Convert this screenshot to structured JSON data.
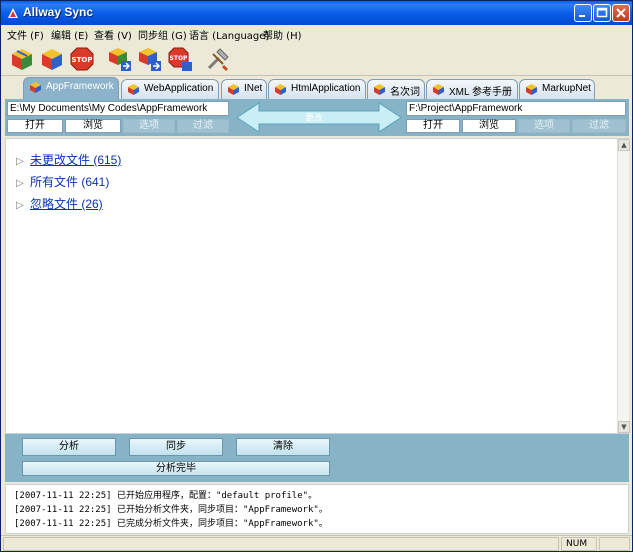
{
  "window": {
    "title": "Allway Sync"
  },
  "menu": [
    "文件 (F)",
    "编辑 (E)",
    "查看 (V)",
    "同步组 (G)",
    "语言 (Language)",
    "帮助 (H)"
  ],
  "toolbar": {
    "icons": [
      "analyze-cube-icon",
      "sync-cube-icon",
      "stop-icon",
      "analyze-all-icon",
      "sync-all-icon",
      "stop-all-icon",
      "tools-icon"
    ],
    "stop_label": "STOP"
  },
  "tabs": [
    {
      "label": "AppFramework",
      "active": true
    },
    {
      "label": "WebApplication",
      "active": false
    },
    {
      "label": "INet",
      "active": false
    },
    {
      "label": "HtmlApplication",
      "active": false
    },
    {
      "label": "名次词",
      "active": false
    },
    {
      "label": "XML 参考手册",
      "active": false
    },
    {
      "label": "MarkupNet",
      "active": false
    }
  ],
  "left_folder": {
    "path": "E:\\My Documents\\My Codes\\AppFramework",
    "buttons": [
      "打开",
      "浏览",
      "选项",
      "过滤"
    ]
  },
  "right_folder": {
    "path": "F:\\Project\\AppFramework",
    "buttons": [
      "打开",
      "浏览",
      "选项",
      "过滤"
    ]
  },
  "sync_direction_label": "更改",
  "tree": [
    {
      "label": "未更改文件 (615)",
      "link": true
    },
    {
      "label": "所有文件 (641)",
      "link": false
    },
    {
      "label": "忽略文件 (26)",
      "link": true
    }
  ],
  "actions": {
    "analyze": "分析",
    "sync": "同步",
    "clear": "清除",
    "status": "分析完毕"
  },
  "log": [
    "[2007-11-11 22:25] 已开始应用程序，配置：\"default profile\"。",
    "[2007-11-11 22:25] 已开始分析文件夹，同步项目：\"AppFramework\"。",
    "[2007-11-11 22:25] 已完成分析文件夹，同步项目：\"AppFramework\"。"
  ],
  "statusbar": {
    "num": "NUM"
  },
  "colors": {
    "title_bar": "#0a5fe8",
    "panel": "#86b3c6",
    "link": "#0a32b4"
  }
}
